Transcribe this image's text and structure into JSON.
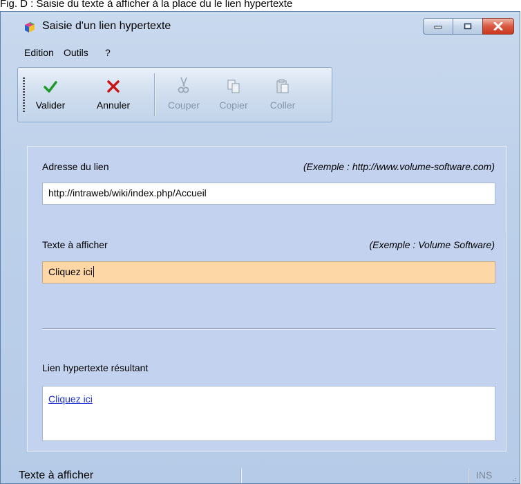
{
  "caption": "Fig. D : Saisie du texte à afficher à la place du le lien hypertexte",
  "window": {
    "title": "Saisie d'un lien hypertexte",
    "caption_buttons": [
      "minimize-icon",
      "maximize-icon",
      "close-icon"
    ]
  },
  "menu": [
    {
      "label": "Edition"
    },
    {
      "label": "Outils"
    },
    {
      "label": "?"
    }
  ],
  "toolbar": {
    "buttons": [
      {
        "label": "Valider",
        "icon": "checkmark-icon",
        "enabled": true
      },
      {
        "label": "Annuler",
        "icon": "cross-icon",
        "enabled": true
      },
      {
        "label": "Couper",
        "icon": "scissors-icon",
        "enabled": false
      },
      {
        "label": "Copier",
        "icon": "copy-icon",
        "enabled": false
      },
      {
        "label": "Coller",
        "icon": "paste-icon",
        "enabled": false
      }
    ]
  },
  "form": {
    "address_label": "Adresse du lien",
    "address_example": "(Exemple : http://www.volume-software.com)",
    "address_value": "http://intraweb/wiki/index.php/Accueil",
    "text_label": "Texte à afficher",
    "text_example": "(Exemple : Volume Software)",
    "text_value": "Cliquez ici",
    "result_label": "Lien hypertexte résultant",
    "result_link": "Cliquez ici"
  },
  "status": {
    "text": "Texte à afficher",
    "mode": "INS"
  },
  "colors": {
    "active_field": "#fdd7a5",
    "link": "#1a2fd0",
    "valider": "#1f9a2a",
    "annuler": "#c81414"
  }
}
